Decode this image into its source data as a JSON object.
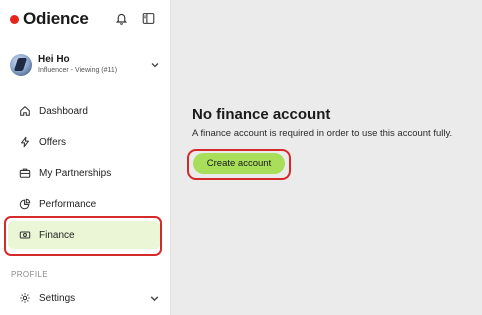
{
  "brand": {
    "name": "Odience",
    "accent": "#e4251b"
  },
  "user": {
    "name": "Hei Ho",
    "role": "Influencer - Viewing (#11)"
  },
  "nav": {
    "items": [
      {
        "label": "Dashboard",
        "icon": "home-icon"
      },
      {
        "label": "Offers",
        "icon": "lightning-icon"
      },
      {
        "label": "My Partnerships",
        "icon": "briefcase-icon"
      },
      {
        "label": "Performance",
        "icon": "pie-chart-icon"
      },
      {
        "label": "Finance",
        "icon": "banknote-icon",
        "active": true
      }
    ],
    "profile_section": "PROFILE",
    "settings": {
      "label": "Settings",
      "icon": "gear-icon"
    }
  },
  "main": {
    "title": "No finance account",
    "subtitle": "A finance account is required in order to use this account fully.",
    "cta_label": "Create account",
    "cta_color": "#a8de5a"
  },
  "colors": {
    "active_bg": "#eaf6d6",
    "highlight": "#d42a2a",
    "main_bg": "#ebebeb"
  }
}
